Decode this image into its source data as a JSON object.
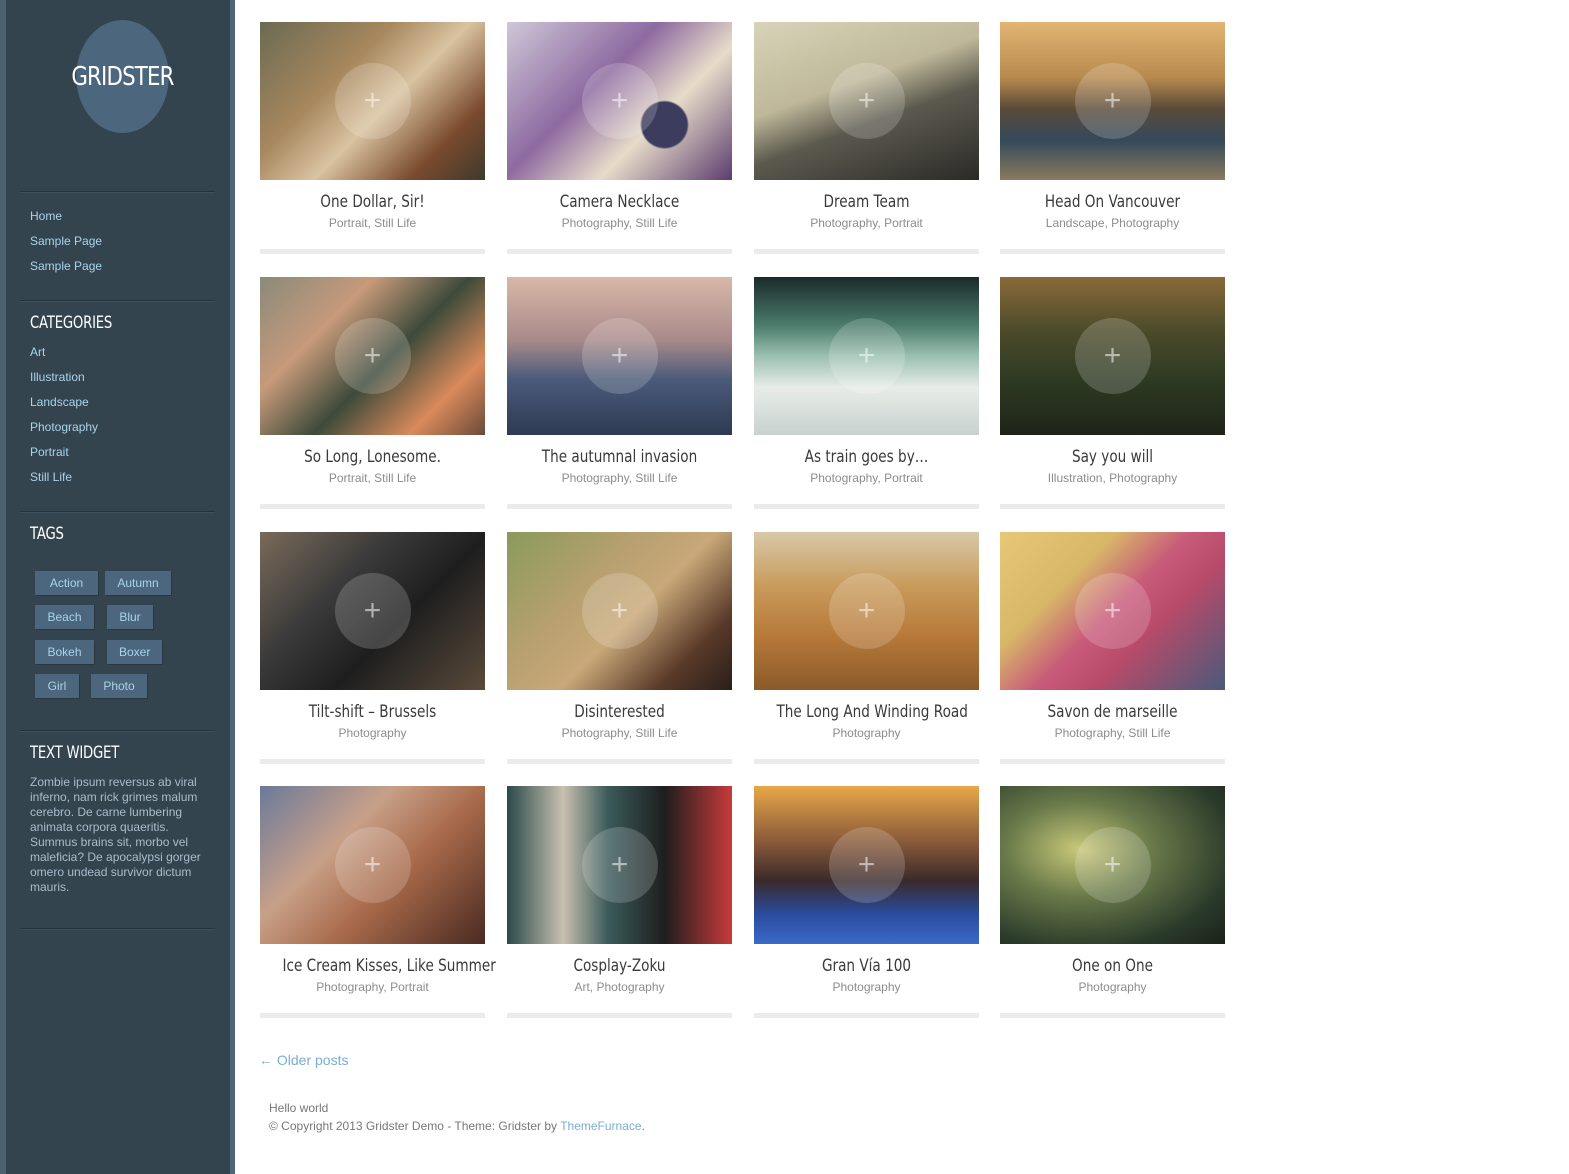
{
  "site": {
    "logo_text": "GRIDSTER"
  },
  "nav": [
    {
      "label": "Home"
    },
    {
      "label": "Sample Page"
    },
    {
      "label": "Sample Page"
    }
  ],
  "categories": {
    "title": "CATEGORIES",
    "items": [
      "Art",
      "Illustration",
      "Landscape",
      "Photography",
      "Portrait",
      "Still Life"
    ]
  },
  "tags": {
    "title": "TAGS",
    "items": [
      "Action",
      "Autumn",
      "Beach",
      "Blur",
      "Bokeh",
      "Boxer",
      "Girl",
      "Photo"
    ]
  },
  "text_widget": {
    "title": "TEXT WIDGET",
    "body": "Zombie ipsum reversus ab viral inferno, nam rick grimes malum cerebro. De carne lumbering animata corpora quaeritis. Summus brains sit, morbo vel maleficia? De apocalypsi gorger omero undead survivor dictum mauris."
  },
  "posts": [
    {
      "title": "One Dollar, Sir!",
      "cats": "Portrait, Still Life"
    },
    {
      "title": "Camera Necklace",
      "cats": "Photography, Still Life"
    },
    {
      "title": "Dream Team",
      "cats": "Photography, Portrait"
    },
    {
      "title": "Head On Vancouver",
      "cats": "Landscape, Photography"
    },
    {
      "title": "So Long, Lonesome.",
      "cats": "Portrait, Still Life"
    },
    {
      "title": "The autumnal invasion",
      "cats": "Photography, Still Life"
    },
    {
      "title": "As train goes by…",
      "cats": "Photography, Portrait"
    },
    {
      "title": "Say you will",
      "cats": "Illustration, Photography"
    },
    {
      "title": "Tilt-shift – Brussels",
      "cats": "Photography"
    },
    {
      "title": "Disinterested",
      "cats": "Photography, Still Life"
    },
    {
      "title": "The Long And Winding Road",
      "cats": "Photography"
    },
    {
      "title": "Savon de marseille",
      "cats": "Photography, Still Life"
    },
    {
      "title": "Ice Cream Kisses, Like Summer",
      "cats": "Photography, Portrait"
    },
    {
      "title": "Cosplay-Zoku",
      "cats": "Art, Photography"
    },
    {
      "title": "Gran Vía 100",
      "cats": "Photography"
    },
    {
      "title": "One on One",
      "cats": "Photography"
    }
  ],
  "pagination": {
    "older": "← Older posts"
  },
  "footer": {
    "line1": "Hello world",
    "copyright": "© Copyright 2013 Gridster Demo - Theme: Gridster by ",
    "link": "ThemeFurnace",
    "end": "."
  }
}
